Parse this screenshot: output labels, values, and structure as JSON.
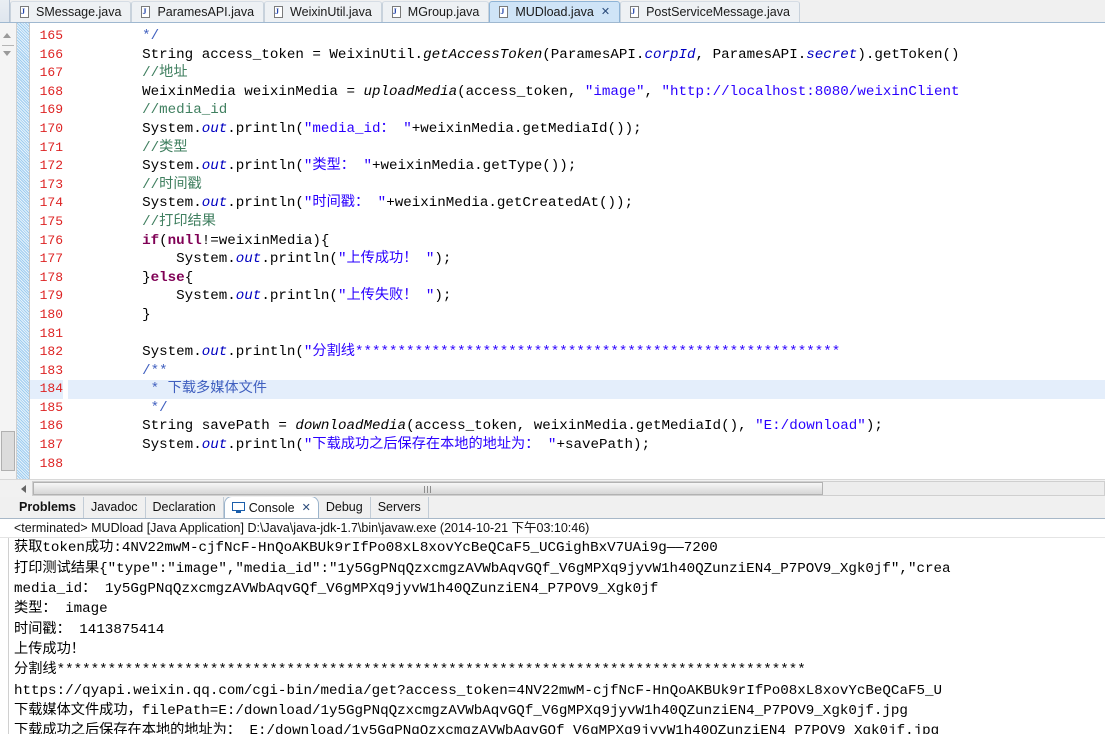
{
  "editor_tabs": [
    {
      "label": "SMessage.java",
      "active": false,
      "closable": false
    },
    {
      "label": "ParamesAPI.java",
      "active": false,
      "closable": false
    },
    {
      "label": "WeixinUtil.java",
      "active": false,
      "closable": false
    },
    {
      "label": "MGroup.java",
      "active": false,
      "closable": false
    },
    {
      "label": "MUDload.java",
      "active": true,
      "closable": true
    },
    {
      "label": "PostServiceMessage.java",
      "active": false,
      "closable": false
    }
  ],
  "icons": {
    "tab_file": "java-file-icon",
    "tab_close": "✕",
    "console": "console-icon",
    "console_close": "✕"
  },
  "editor": {
    "first_line_number": 165,
    "highlighted_line": 184,
    "last_line_number": 188,
    "lines": [
      {
        "n": 165,
        "segments": [
          {
            "t": "        ",
            "c": ""
          },
          {
            "t": "*/",
            "c": "jdoc"
          }
        ]
      },
      {
        "n": 166,
        "segments": [
          {
            "t": "        String access_token = WeixinUtil.",
            "c": ""
          },
          {
            "t": "getAccessToken",
            "c": "mth"
          },
          {
            "t": "(ParamesAPI.",
            "c": ""
          },
          {
            "t": "corpId",
            "c": "fld"
          },
          {
            "t": ", ParamesAPI.",
            "c": ""
          },
          {
            "t": "secret",
            "c": "fld"
          },
          {
            "t": ").getToken()",
            "c": ""
          }
        ]
      },
      {
        "n": 167,
        "segments": [
          {
            "t": "        ",
            "c": ""
          },
          {
            "t": "//地址",
            "c": "cmt"
          }
        ]
      },
      {
        "n": 168,
        "segments": [
          {
            "t": "        WeixinMedia weixinMedia = ",
            "c": ""
          },
          {
            "t": "uploadMedia",
            "c": "mth"
          },
          {
            "t": "(access_token, ",
            "c": ""
          },
          {
            "t": "\"image\"",
            "c": "str"
          },
          {
            "t": ", ",
            "c": ""
          },
          {
            "t": "\"http://localhost:8080/weixinClient",
            "c": "str"
          }
        ]
      },
      {
        "n": 169,
        "segments": [
          {
            "t": "        ",
            "c": ""
          },
          {
            "t": "//media_id",
            "c": "cmt"
          }
        ]
      },
      {
        "n": 170,
        "segments": [
          {
            "t": "        System.",
            "c": ""
          },
          {
            "t": "out",
            "c": "fld"
          },
          {
            "t": ".println(",
            "c": ""
          },
          {
            "t": "\"media_id： \"",
            "c": "str"
          },
          {
            "t": "+weixinMedia.getMediaId());",
            "c": ""
          }
        ]
      },
      {
        "n": 171,
        "segments": [
          {
            "t": "        ",
            "c": ""
          },
          {
            "t": "//类型",
            "c": "cmt"
          }
        ]
      },
      {
        "n": 172,
        "segments": [
          {
            "t": "        System.",
            "c": ""
          },
          {
            "t": "out",
            "c": "fld"
          },
          {
            "t": ".println(",
            "c": ""
          },
          {
            "t": "\"类型： \"",
            "c": "str"
          },
          {
            "t": "+weixinMedia.getType());",
            "c": ""
          }
        ]
      },
      {
        "n": 173,
        "segments": [
          {
            "t": "        ",
            "c": ""
          },
          {
            "t": "//时间戳",
            "c": "cmt"
          }
        ]
      },
      {
        "n": 174,
        "segments": [
          {
            "t": "        System.",
            "c": ""
          },
          {
            "t": "out",
            "c": "fld"
          },
          {
            "t": ".println(",
            "c": ""
          },
          {
            "t": "\"时间戳： \"",
            "c": "str"
          },
          {
            "t": "+weixinMedia.getCreatedAt());",
            "c": ""
          }
        ]
      },
      {
        "n": 175,
        "segments": [
          {
            "t": "        ",
            "c": ""
          },
          {
            "t": "//打印结果",
            "c": "cmt"
          }
        ]
      },
      {
        "n": 176,
        "segments": [
          {
            "t": "        ",
            "c": ""
          },
          {
            "t": "if",
            "c": "kw"
          },
          {
            "t": "(",
            "c": ""
          },
          {
            "t": "null",
            "c": "kw"
          },
          {
            "t": "!=weixinMedia){",
            "c": ""
          }
        ]
      },
      {
        "n": 177,
        "segments": [
          {
            "t": "            System.",
            "c": ""
          },
          {
            "t": "out",
            "c": "fld"
          },
          {
            "t": ".println(",
            "c": ""
          },
          {
            "t": "\"上传成功！ \"",
            "c": "str"
          },
          {
            "t": ");",
            "c": ""
          }
        ]
      },
      {
        "n": 178,
        "segments": [
          {
            "t": "        }",
            "c": ""
          },
          {
            "t": "else",
            "c": "kw"
          },
          {
            "t": "{",
            "c": ""
          }
        ]
      },
      {
        "n": 179,
        "segments": [
          {
            "t": "            System.",
            "c": ""
          },
          {
            "t": "out",
            "c": "fld"
          },
          {
            "t": ".println(",
            "c": ""
          },
          {
            "t": "\"上传失败！ \"",
            "c": "str"
          },
          {
            "t": ");",
            "c": ""
          }
        ]
      },
      {
        "n": 180,
        "segments": [
          {
            "t": "        }",
            "c": ""
          }
        ]
      },
      {
        "n": 181,
        "segments": [
          {
            "t": "",
            "c": ""
          }
        ]
      },
      {
        "n": 182,
        "segments": [
          {
            "t": "        System.",
            "c": ""
          },
          {
            "t": "out",
            "c": "fld"
          },
          {
            "t": ".println(",
            "c": ""
          },
          {
            "t": "\"分割线*********************************************************",
            "c": "str"
          }
        ]
      },
      {
        "n": 183,
        "segments": [
          {
            "t": "        ",
            "c": ""
          },
          {
            "t": "/**",
            "c": "jdoc"
          }
        ]
      },
      {
        "n": 184,
        "segments": [
          {
            "t": "         ",
            "c": ""
          },
          {
            "t": "* 下载多媒体文件",
            "c": "jdoc"
          }
        ]
      },
      {
        "n": 185,
        "segments": [
          {
            "t": "         ",
            "c": ""
          },
          {
            "t": "*/",
            "c": "jdoc"
          }
        ]
      },
      {
        "n": 186,
        "segments": [
          {
            "t": "        String savePath = ",
            "c": ""
          },
          {
            "t": "downloadMedia",
            "c": "mth"
          },
          {
            "t": "(access_token, weixinMedia.getMediaId(), ",
            "c": ""
          },
          {
            "t": "\"E:/download\"",
            "c": "str"
          },
          {
            "t": ");",
            "c": ""
          }
        ]
      },
      {
        "n": 187,
        "segments": [
          {
            "t": "        System.",
            "c": ""
          },
          {
            "t": "out",
            "c": "fld"
          },
          {
            "t": ".println(",
            "c": ""
          },
          {
            "t": "\"下载成功之后保存在本地的地址为： \"",
            "c": "str"
          },
          {
            "t": "+savePath);",
            "c": ""
          }
        ]
      },
      {
        "n": 188,
        "segments": [
          {
            "t": "",
            "c": ""
          }
        ]
      }
    ]
  },
  "view_tabs": [
    {
      "label": "Problems",
      "active": false,
      "bold": true,
      "icon": null,
      "closable": false
    },
    {
      "label": "Javadoc",
      "active": false,
      "bold": false,
      "icon": null,
      "closable": false
    },
    {
      "label": "Declaration",
      "active": false,
      "bold": false,
      "icon": null,
      "closable": false
    },
    {
      "label": "Console",
      "active": true,
      "bold": false,
      "icon": "console-icon",
      "closable": true
    },
    {
      "label": "Debug",
      "active": false,
      "bold": false,
      "icon": null,
      "closable": false
    },
    {
      "label": "Servers",
      "active": false,
      "bold": false,
      "icon": null,
      "closable": false
    }
  ],
  "console": {
    "header": "<terminated> MUDload [Java Application] D:\\Java\\java-jdk-1.7\\bin\\javaw.exe (2014-10-21 下午03:10:46)",
    "lines": [
      "获取token成功:4NV22mwM-cjfNcF-HnQoAKBUk9rIfPo08xL8xovYcBeQCaF5_UCGighBxV7UAi9g——7200",
      "打印测试结果{\"type\":\"image\",\"media_id\":\"1y5GgPNqQzxcmgzAVWbAqvGQf_V6gMPXq9jyvW1h40QZunziEN4_P7POV9_Xgk0jf\",\"crea",
      "media_id： 1y5GgPNqQzxcmgzAVWbAqvGQf_V6gMPXq9jyvW1h40QZunziEN4_P7POV9_Xgk0jf",
      "类型： image",
      "时间戳： 1413875414",
      "上传成功！",
      "分割线****************************************************************************************",
      "https://qyapi.weixin.qq.com/cgi-bin/media/get?access_token=4NV22mwM-cjfNcF-HnQoAKBUk9rIfPo08xL8xovYcBeQCaF5_U",
      "下载媒体文件成功，filePath=E:/download/1y5GgPNqQzxcmgzAVWbAqvGQf_V6gMPXq9jyvW1h40QZunziEN4_P7POV9_Xgk0jf.jpg",
      "下载成功之后保存在本地的地址为： E:/download/1y5GgPNqQzxcmgzAVWbAqvGQf_V6gMPXq9jyvW1h40QZunziEN4_P7POV9_Xgk0jf.jpg"
    ]
  },
  "colors": {
    "active_tab_bg": "#cfe4f7",
    "line_number": "#dd2222",
    "string": "#2a00ff",
    "comment": "#3f7f5f",
    "keyword": "#7f0055",
    "field": "#0000c0",
    "javadoc": "#3f5fbf",
    "highlight_line_bg": "#e4eefb"
  }
}
